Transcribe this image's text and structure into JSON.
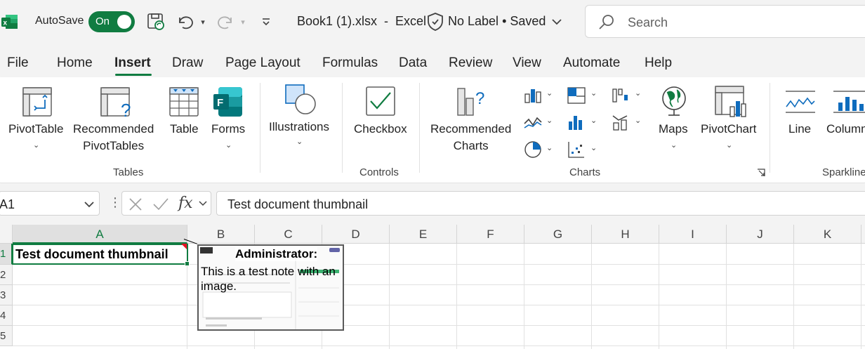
{
  "titlebar": {
    "autosave_label": "AutoSave",
    "autosave_state": "On",
    "document_title": "Book1 (1).xlsx  -  Excel",
    "sensitivity_label": "No Label",
    "save_status": "Saved",
    "separator": "•",
    "search_placeholder": "Search"
  },
  "menu_tabs": [
    "File",
    "Home",
    "Insert",
    "Draw",
    "Page Layout",
    "Formulas",
    "Data",
    "Review",
    "View",
    "Automate",
    "Help"
  ],
  "active_tab": "Insert",
  "ribbon": {
    "pivot_table": "PivotTable",
    "recommended_pivot_line1": "Recommended",
    "recommended_pivot_line2": "PivotTables",
    "table": "Table",
    "forms": "Forms",
    "group_tables": "Tables",
    "illustrations": "Illustrations",
    "checkbox": "Checkbox",
    "group_controls": "Controls",
    "recommended_charts_line1": "Recommended",
    "recommended_charts_line2": "Charts",
    "maps": "Maps",
    "pivot_chart": "PivotChart",
    "group_charts": "Charts",
    "line": "Line",
    "column": "Column",
    "group_sparklines": "Sparklines"
  },
  "formula_bar": {
    "name_box": "A1",
    "fx": "fx",
    "content": "Test document thumbnail"
  },
  "grid": {
    "columns": [
      "A",
      "B",
      "C",
      "D",
      "E",
      "F",
      "G",
      "H",
      "I",
      "J",
      "K"
    ],
    "rows": [
      "1",
      "2",
      "3",
      "4",
      "5"
    ],
    "selected_column": "A",
    "selected_row": "1",
    "cell_a1": "Test document thumbnail"
  },
  "note": {
    "author": "Administrator:",
    "body": "This is a test note with an image."
  },
  "colors": {
    "accent": "#107c41",
    "titlebar_bg": "#f3f3f3",
    "note_indicator": "#e81123"
  }
}
